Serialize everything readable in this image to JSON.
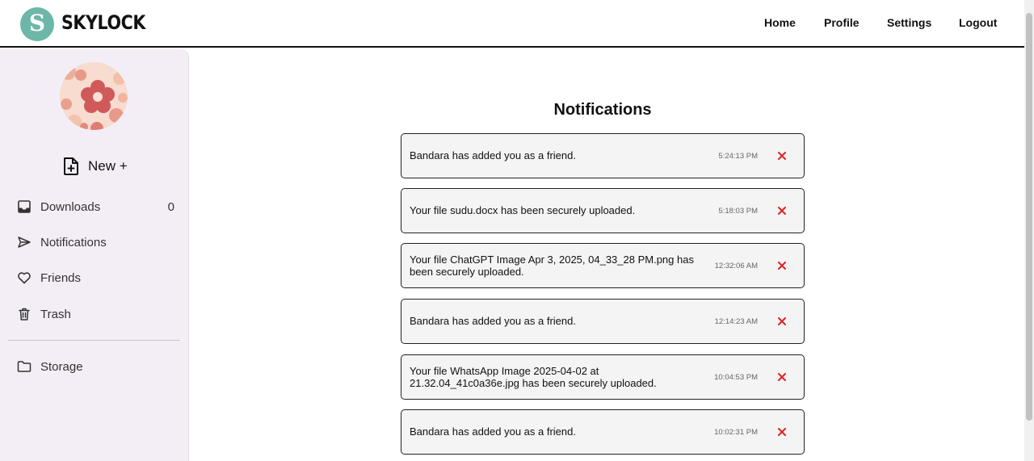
{
  "header": {
    "logo_letter": "S",
    "brand": "SKYLOCK",
    "nav": {
      "home": "Home",
      "profile": "Profile",
      "settings": "Settings",
      "logout": "Logout"
    }
  },
  "sidebar": {
    "new_label": "New +",
    "items": {
      "downloads": {
        "label": "Downloads",
        "count": "0",
        "icon": "inbox-icon"
      },
      "notifications": {
        "label": "Notifications",
        "icon": "send-icon"
      },
      "friends": {
        "label": "Friends",
        "icon": "heart-icon"
      },
      "trash": {
        "label": "Trash",
        "icon": "trash-icon"
      },
      "storage": {
        "label": "Storage",
        "icon": "folder-icon"
      }
    }
  },
  "main": {
    "title": "Notifications",
    "notifications": [
      {
        "message": "Bandara has added you as a friend.",
        "time": "5:24:13 PM"
      },
      {
        "message": "Your file sudu.docx has been securely uploaded.",
        "time": "5:18:03 PM"
      },
      {
        "message": "Your file ChatGPT Image Apr 3, 2025, 04_33_28 PM.png has been securely uploaded.",
        "time": "12:32:06 AM"
      },
      {
        "message": "Bandara has added you as a friend.",
        "time": "12:14:23 AM"
      },
      {
        "message": "Your file WhatsApp Image 2025-04-02 at 21.32.04_41c0a36e.jpg has been securely uploaded.",
        "time": "10:04:53 PM"
      },
      {
        "message": "Bandara has added you as a friend.",
        "time": "10:02:31 PM"
      }
    ]
  },
  "colors": {
    "logo": "#6cb7a8",
    "sidebar_bg": "#f3eef6",
    "close_icon": "#e02424",
    "card_bg": "#f4f4f4"
  }
}
